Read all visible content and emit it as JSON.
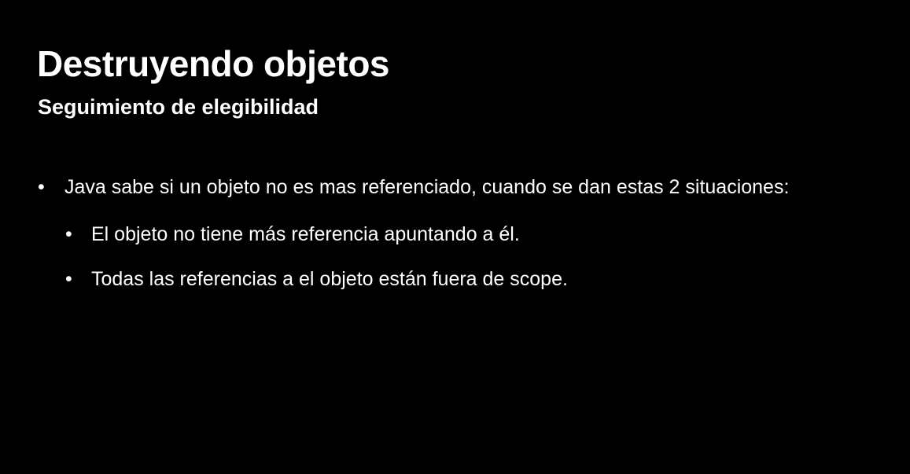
{
  "slide": {
    "title": "Destruyendo objetos",
    "subtitle": "Seguimiento de elegibilidad",
    "bullet_marker": "•",
    "bullets": [
      {
        "text": "Java sabe si un objeto no es mas referenciado, cuando se dan estas 2 situaciones:",
        "sub_bullets": [
          "El objeto no tiene más referencia apuntando a él.",
          "Todas las referencias a el objeto están fuera de scope."
        ]
      }
    ]
  },
  "colors": {
    "background": "#000000",
    "text": "#ffffff"
  }
}
